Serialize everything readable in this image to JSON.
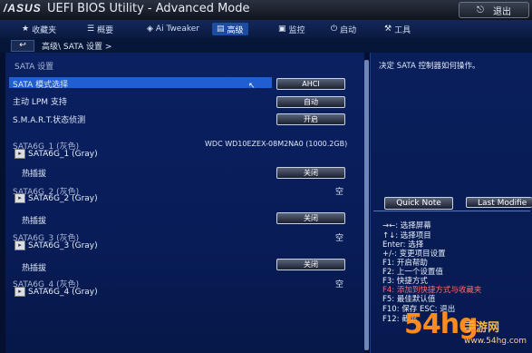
{
  "header": {
    "logo": "/ASUS",
    "title": "UEFI BIOS Utility - Advanced Mode",
    "exit_label": "退出",
    "exit_icon": "exit-icon"
  },
  "tabs": [
    {
      "label": "收藏夹",
      "icon": "star-icon"
    },
    {
      "label": "概要",
      "icon": "list-icon"
    },
    {
      "label": "Ai Tweaker",
      "icon": "tweak-icon"
    },
    {
      "label": "高级",
      "icon": "advanced-icon",
      "active": true
    },
    {
      "label": "监控",
      "icon": "monitor-icon"
    },
    {
      "label": "启动",
      "icon": "power-icon"
    },
    {
      "label": "工具",
      "icon": "tool-icon"
    }
  ],
  "breadcrumb": {
    "back_label": "↩",
    "path": "高级\\ SATA 设置 >"
  },
  "main": {
    "section_title": "SATA 设置",
    "rows": [
      {
        "label": "SATA 模式选择",
        "value": "AHCI"
      },
      {
        "label": "主动 LPM 支持",
        "value": "自动"
      },
      {
        "label": "S.M.A.R.T.状态侦测",
        "value": "开启"
      }
    ],
    "ports": [
      {
        "port": "SATA6G_1 (灰色)",
        "name": "SATA6G_1 (Gray)",
        "device": "WDC WD10EZEX-08M2NA0 (1000.2GB)",
        "hotplug_label": "热插拔",
        "hotplug_value": "关闭"
      },
      {
        "port": "SATA6G_2 (灰色)",
        "name": "SATA6G_2 (Gray)",
        "device": "空",
        "hotplug_label": "热插拔",
        "hotplug_value": "关闭"
      },
      {
        "port": "SATA6G_3 (灰色)",
        "name": "SATA6G_3 (Gray)",
        "device": "空",
        "hotplug_label": "热插拔",
        "hotplug_value": "关闭"
      },
      {
        "port": "SATA6G_4 (灰色)",
        "name": "SATA6G_4 (Gray)",
        "device": "空"
      }
    ]
  },
  "side": {
    "description": "决定 SATA 控制器如何操作。",
    "quick_note": "Quick Note",
    "last_modified": "Last Modifie",
    "help": [
      {
        "text": "→←: 选择屏幕"
      },
      {
        "text": "↑↓: 选择项目"
      },
      {
        "text": "Enter: 选择"
      },
      {
        "text": "+/-: 变更项目设置"
      },
      {
        "text": "F1: 开启帮助"
      },
      {
        "text": "F2: 上一个设置值"
      },
      {
        "text": "F3: 快捷方式"
      },
      {
        "text": "F4: 添加到快捷方式与收藏夹",
        "hot": true
      },
      {
        "text": "F5: 最佳默认值"
      },
      {
        "text": "F10: 保存  ESC: 退出"
      },
      {
        "text": "F12: 截屏"
      }
    ]
  },
  "watermark": {
    "big": "54hg",
    "small": "手游网",
    "url": "www.54hg.com"
  },
  "colors": {
    "highlight": "#1f5fd0",
    "panel": "#0a2060",
    "hotkey": "#ff6b6b",
    "watermark": "#ff8a1e"
  }
}
